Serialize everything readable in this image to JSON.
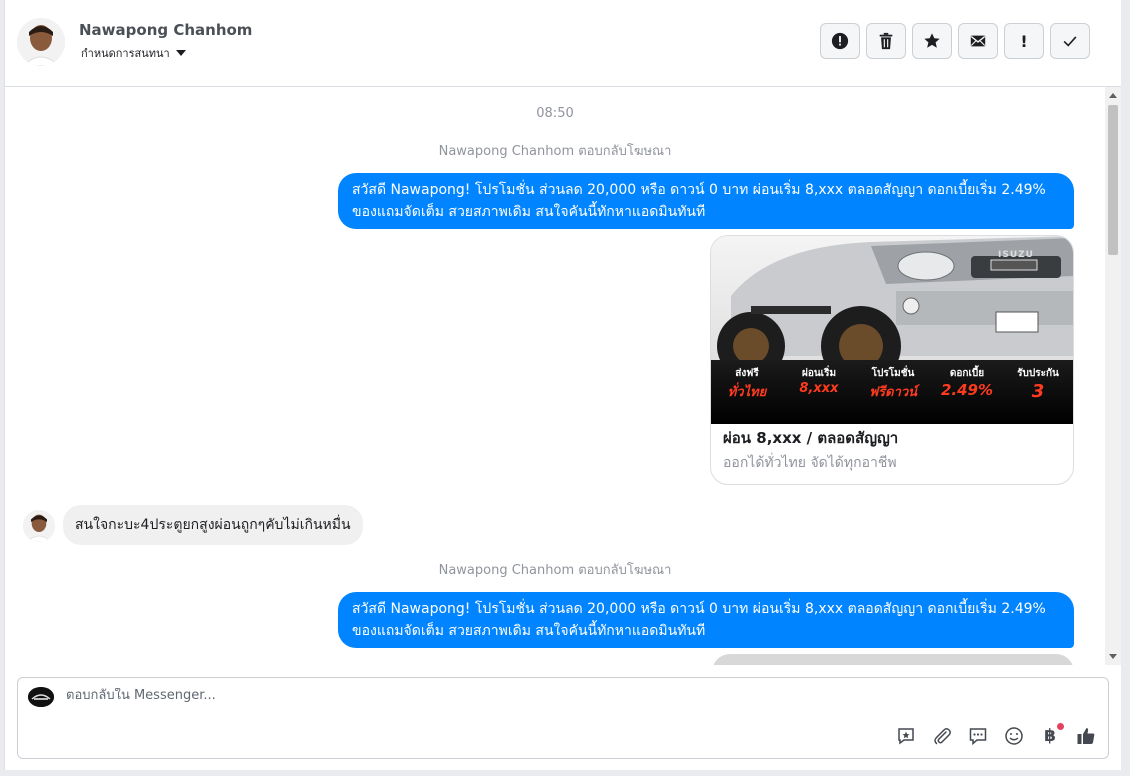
{
  "header": {
    "contact_name": "Nawapong Chanhom",
    "assign_label": "กำหนดการสนทนา",
    "actions": [
      {
        "name": "spam-alert",
        "icon": "alert-circle-icon"
      },
      {
        "name": "delete",
        "icon": "trash-icon"
      },
      {
        "name": "star",
        "icon": "star-icon"
      },
      {
        "name": "mark-unread",
        "icon": "envelope-icon"
      },
      {
        "name": "important",
        "icon": "exclamation-icon"
      },
      {
        "name": "done",
        "icon": "check-icon"
      }
    ]
  },
  "conversation": {
    "timestamp": "08:50",
    "system_1": "Nawapong Chanhom ตอบกลับโฆษณา",
    "outgoing_1": "สวัสดี Nawapong! โปรโมชั่น ส่วนลด 20,000 หรือ ดาวน์ 0 บาท ผ่อนเริ่ม 8,xxx ตลอดสัญญา ดอกเบี้ยเริ่ม 2.49% ของแถมจัดเต็ม สวยสภาพเดิม สนใจคันนี้ทักหาแอดมินทันที",
    "card": {
      "brand_badge": "ISUZU",
      "promo_cols": [
        {
          "top": "ส่งฟรี",
          "bottom": "ทั่วไทย"
        },
        {
          "top": "ผ่อนเริ่ม",
          "bottom": "8,xxx"
        },
        {
          "top": "โปรโมชั่น",
          "bottom": "ฟรีดาวน์"
        },
        {
          "top": "ดอกเบี้ย",
          "bottom": "2.49%"
        },
        {
          "top": "รับประกัน",
          "bottom": "3"
        }
      ],
      "title": "ผ่อน 8,xxx / ตลอดสัญญา",
      "description": "ออกได้ทั่วไทย จัดได้ทุกอาชีพ"
    },
    "incoming_1": "สนใจกะบะ4ประตูยกสูงผ่อนถูกๆคับไม่เกินหมื่น",
    "system_2": "Nawapong Chanhom ตอบกลับโฆษณา",
    "outgoing_2": "สวัสดี Nawapong! โปรโมชั่น ส่วนลด 20,000 หรือ ดาวน์ 0 บาท ผ่อนเริ่ม 8,xxx ตลอดสัญญา ดอกเบี้ยเริ่ม 2.49% ของแถมจัดเต็ม สวยสภาพเดิม สนใจคันนี้ทักหาแอดมินทันที"
  },
  "composer": {
    "placeholder": "ตอบกลับใน Messenger...",
    "tools": [
      "saved-reply-icon",
      "attachment-icon",
      "chat-bubble-icon",
      "emoji-icon",
      "baht-payment-icon",
      "thumbs-up-icon"
    ],
    "baht_symbol": "฿"
  },
  "colors": {
    "outgoing_bubble": "#0084ff",
    "incoming_bubble": "#f1f0f0",
    "promo_accent": "#ff3b1f"
  }
}
